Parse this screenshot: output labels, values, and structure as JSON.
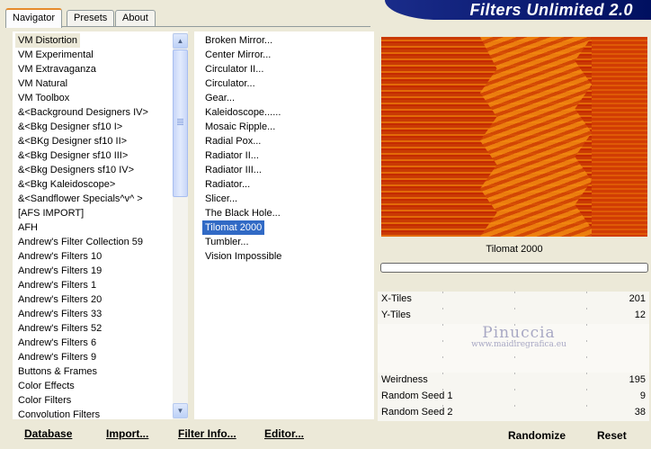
{
  "tabs": [
    {
      "label": "Navigator",
      "active": true
    },
    {
      "label": "Presets",
      "active": false
    },
    {
      "label": "About",
      "active": false
    }
  ],
  "banner": {
    "title": "Filters Unlimited 2.0"
  },
  "categories": [
    "VM Distortion",
    "VM Experimental",
    "VM Extravaganza",
    "VM Natural",
    "VM Toolbox",
    "&<Background Designers IV>",
    "&<Bkg Designer sf10 I>",
    "&<BKg Designer sf10 II>",
    "&<Bkg Designer sf10 III>",
    "&<Bkg Designers sf10 IV>",
    "&<Bkg Kaleidoscope>",
    "&<Sandflower Specials^v^ >",
    "[AFS IMPORT]",
    "AFH",
    "Andrew's Filter Collection 59",
    "Andrew's Filters 10",
    "Andrew's Filters 19",
    "Andrew's Filters 1",
    "Andrew's Filters 20",
    "Andrew's Filters 33",
    "Andrew's Filters 52",
    "Andrew's Filters 6",
    "Andrew's Filters 9",
    "Buttons & Frames",
    "Color Effects",
    "Color Filters",
    "Convolution Filters"
  ],
  "selected_category": "VM Distortion",
  "filters": [
    "Broken Mirror...",
    "Center Mirror...",
    "Circulator II...",
    "Circulator...",
    "Gear...",
    "Kaleidoscope......",
    "Mosaic Ripple...",
    "Radial Pox...",
    "Radiator II...",
    "Radiator III...",
    "Radiator...",
    "Slicer...",
    "The Black Hole...",
    "Tilomat 2000",
    "Tumbler...",
    "Vision Impossible"
  ],
  "selected_filter": "Tilomat 2000",
  "bottom_buttons": {
    "database": "Database",
    "import": "Import...",
    "filter_info": "Filter Info...",
    "editor": "Editor..."
  },
  "filter_title": "Tilomat 2000",
  "controls": [
    {
      "label": "X-Tiles",
      "value": "201"
    },
    {
      "label": "Y-Tiles",
      "value": "12"
    },
    {
      "label": "",
      "value": ""
    },
    {
      "label": "",
      "value": ""
    },
    {
      "label": "",
      "value": ""
    },
    {
      "label": "Weirdness",
      "value": "195"
    },
    {
      "label": "Random Seed 1",
      "value": "9"
    },
    {
      "label": "Random Seed 2",
      "value": "38"
    }
  ],
  "watermark": {
    "line1": "Pinuccia",
    "line2": "www.maidiregrafica.eu"
  },
  "right_buttons": {
    "randomize": "Randomize",
    "reset": "Reset"
  },
  "colors": {
    "selection": "#316ac5",
    "banner": "#0a1a70",
    "tab_accent": "#e68b2c"
  }
}
